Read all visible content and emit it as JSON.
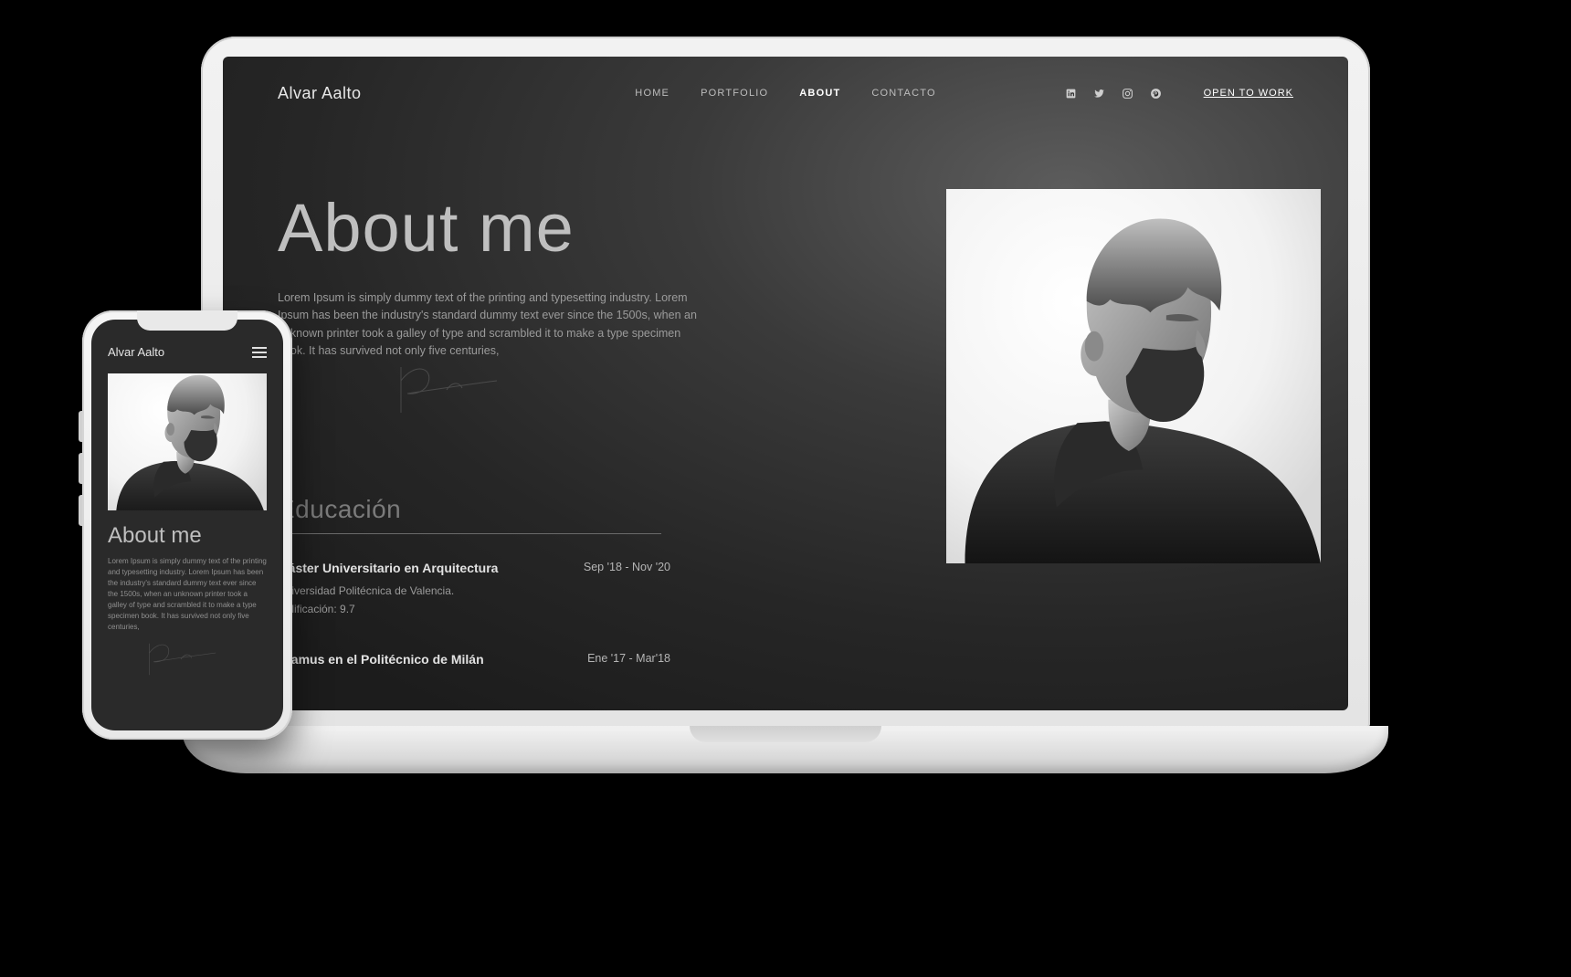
{
  "site_name": "Alvar Aalto",
  "nav": {
    "items": [
      {
        "label": "HOME",
        "active": false
      },
      {
        "label": "PORTFOLIO",
        "active": false
      },
      {
        "label": "ABOUT",
        "active": true
      },
      {
        "label": "CONTACTO",
        "active": false
      }
    ],
    "cta": "OPEN TO WORK"
  },
  "social_icons": [
    "linkedin",
    "twitter",
    "instagram",
    "pinterest"
  ],
  "about": {
    "heading": "About me",
    "body": "Lorem Ipsum is simply dummy text of the printing and typesetting industry. Lorem Ipsum has been the industry's standard dummy text ever since the 1500s, when an unknown printer took a galley of type and scrambled it to make a type specimen book. It has survived not only five centuries,"
  },
  "education": {
    "heading": "Educación",
    "items": [
      {
        "title": "Máster Universitario en Arquitectura",
        "dates": "Sep '18 - Nov '20",
        "school": "Universidad Politécnica de Valencia.",
        "grade": "Calificación: 9.7"
      },
      {
        "title": "Eramus en el Politécnico de Milán",
        "dates": "Ene '17 - Mar'18"
      }
    ]
  },
  "mobile": {
    "logo": "Alvar Aalto",
    "heading": "About me",
    "body": "Lorem Ipsum is simply dummy text of the printing and typesetting industry. Lorem Ipsum has been the industry's standard dummy text ever since the 1500s, when an unknown printer took a galley of type and scrambled it to make a type specimen book. It has survived not only five centuries,"
  }
}
